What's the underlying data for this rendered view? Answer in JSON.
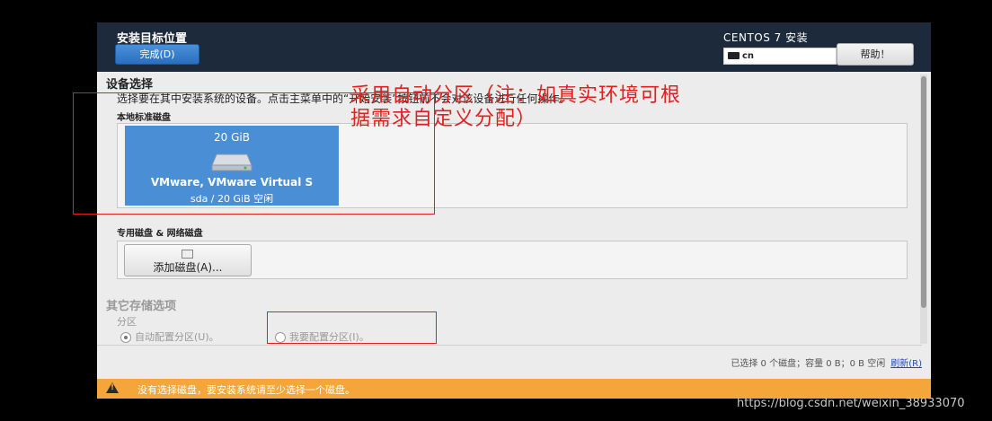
{
  "header": {
    "spoke_title": "安装目标位置",
    "done_button": "完成(D)",
    "product": "CENTOS 7 安装",
    "keyboard_layout": "cn",
    "help_button": "帮助！"
  },
  "device_selection": {
    "title": "设备选择",
    "description": "选择要在其中安装系统的设备。点击主菜单中的“开始安装”按钮前不会对该设备进行任何操作。",
    "local_disks_title": "本地标准磁盘",
    "disk": {
      "size": "20 GiB",
      "name": "VMware, VMware Virtual S",
      "info": "sda   /    20 GiB 空闲"
    }
  },
  "annotation": {
    "line1": "采用自动分区（注：如真实环境可根",
    "line2": "据需求自定义分配）"
  },
  "specialized": {
    "title": "专用磁盘 & 网络磁盘",
    "add_disk_button": "添加磁盘(A)..."
  },
  "other_options": {
    "title": "其它存储选项",
    "partition_label": "分区",
    "auto_option": "自动配置分区(U)。",
    "manual_option": "我要配置分区(I)。",
    "auto_selected": true
  },
  "status": {
    "summary": "已选择 0 个磁盘；容量 0 B；0 B 空闲",
    "refresh_link": "刷新(R)"
  },
  "warning": {
    "icon": "warning-icon",
    "text": "没有选择磁盘，要安装系统请至少选择一个磁盘。"
  },
  "watermark": "https://blog.csdn.net/weixin_38933070",
  "colors": {
    "header_bg": "#1d2a3b",
    "disk_selected": "#4a8fd6",
    "warning_bar": "#f4a63a",
    "annotation": "#e02020"
  }
}
